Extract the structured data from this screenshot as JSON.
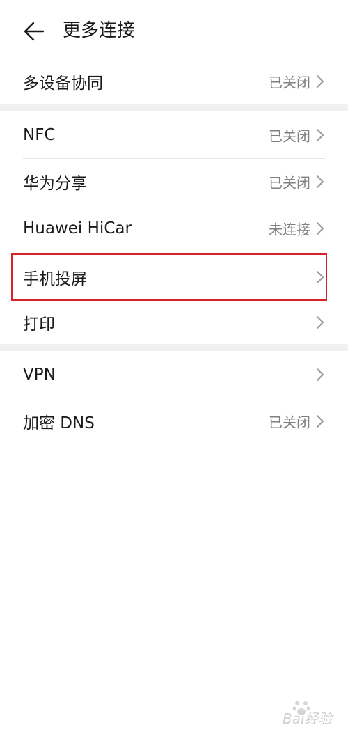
{
  "header": {
    "title": "更多连接",
    "back_icon": "arrow-left-icon"
  },
  "items": [
    {
      "label": "多设备协同",
      "status": "已关闭"
    },
    {
      "label": "NFC",
      "status": "已关闭"
    },
    {
      "label": "华为分享",
      "status": "已关闭"
    },
    {
      "label": "Huawei HiCar",
      "status": "未连接"
    },
    {
      "label": "手机投屏",
      "status": ""
    },
    {
      "label": "打印",
      "status": ""
    },
    {
      "label": "VPN",
      "status": ""
    },
    {
      "label": "加密 DNS",
      "status": "已关闭"
    }
  ],
  "highlight_color": "#d8232a",
  "watermark": {
    "text": "Bai经验"
  }
}
